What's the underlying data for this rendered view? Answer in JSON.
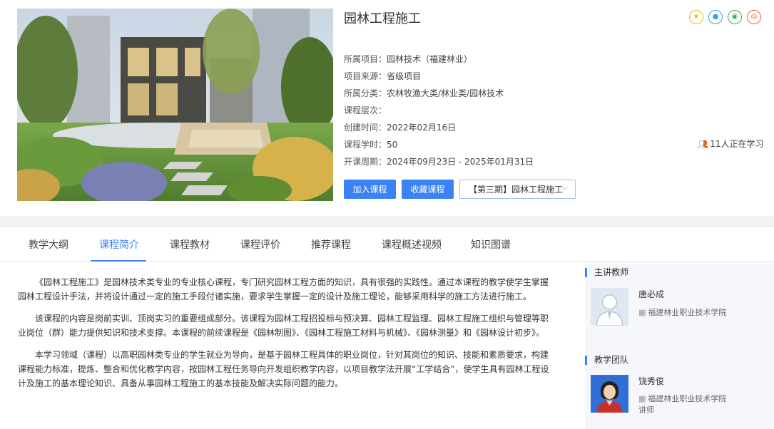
{
  "course": {
    "title": "园林工程施工",
    "info": [
      {
        "label": "所属项目：",
        "value": "园林技术（福建林业）"
      },
      {
        "label": "项目来源：",
        "value": "省级项目"
      },
      {
        "label": "所属分类：",
        "value": "农林牧渔大类/林业类/园林技术"
      },
      {
        "label": "课程层次：",
        "value": ""
      },
      {
        "label": "创建时间：",
        "value": "2022年02月16日"
      },
      {
        "label": "课程学时：",
        "value": "50"
      },
      {
        "label": "开课周期：",
        "value": "2024年09月23日 - 2025年01月31日"
      }
    ],
    "learning_count": "11人正在学习",
    "join_label": "加入课程",
    "fav_label": "收藏课程",
    "term_select": "【第三期】园林工程施工"
  },
  "share_icons": [
    "star-icon",
    "qq-icon",
    "wechat-icon",
    "weibo-icon"
  ],
  "tabs": [
    "教学大纲",
    "课程简介",
    "课程教材",
    "课程评价",
    "推荐课程",
    "课程概述视频",
    "知识图谱"
  ],
  "active_tab": "课程简介",
  "description": [
    "《园林工程施工》是园林技术类专业的专业核心课程，专门研究园林工程方面的知识，具有很强的实践性。通过本课程的教学使学生掌握园林工程设计手法，并将设计通过一定的施工手段付诸实施，要求学生掌握一定的设计及施工理论，能够采用科学的施工方法进行施工。",
    "该课程的内容是岗前实训、顶岗实习的重要组成部分。该课程为园林工程招投标与预决算、园林工程监理、园林工程施工组织与管理等职业岗位（群）能力提供知识和技术支撑。本课程的前续课程是《园林制图》、《园林工程施工材料与机械》、《园林测量》和《园林设计初步》。",
    "本学习领域（课程）以高职园林类专业的学生就业为导向，是基于园林工程具体的职业岗位，针对其岗位的知识、技能和素质要求，构建课程能力标准，提炼、整合和优化教学内容，按园林工程任务导向开发组织教学内容，以项目教学法开展“工学结合”，使学生具有园林工程设计及施工的基本理论知识、具备从事园林工程施工的基本技能及解决实际问题的能力。"
  ],
  "sidebar": {
    "lead_title": "主讲教师",
    "lead": {
      "name": "唐必成",
      "school": "福建林业职业技术学院"
    },
    "team_title": "教学团队",
    "team": {
      "name": "饶秀俊",
      "school": "福建林业职业技术学院",
      "role": "讲师"
    }
  },
  "colors": {
    "accent": "#3b82f6",
    "background": "#f0f2f5"
  }
}
